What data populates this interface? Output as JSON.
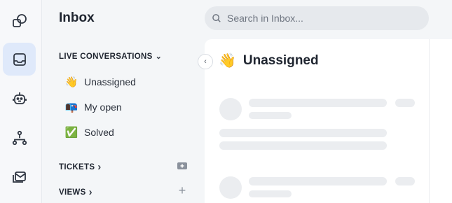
{
  "rail": {
    "items": [
      {
        "name": "shapes-icon",
        "active": false
      },
      {
        "name": "inbox-icon",
        "active": true
      },
      {
        "name": "bot-icon",
        "active": false
      },
      {
        "name": "org-chart-icon",
        "active": false
      },
      {
        "name": "mail-stack-icon",
        "active": false
      }
    ]
  },
  "sidebar": {
    "title": "Inbox",
    "live_section": {
      "label": "LIVE CONVERSATIONS",
      "chevron": "⌄"
    },
    "items": [
      {
        "emoji": "👋",
        "label": "Unassigned"
      },
      {
        "emoji": "📭",
        "label": "My open"
      },
      {
        "emoji": "✅",
        "label": "Solved"
      }
    ],
    "tickets_section": {
      "label": "TICKETS",
      "chevron": "›"
    },
    "views_section": {
      "label": "VIEWS",
      "chevron": "›",
      "action": "+"
    }
  },
  "search": {
    "placeholder": "Search in Inbox..."
  },
  "collapse": {
    "glyph": "‹"
  },
  "main": {
    "emoji": "👋",
    "title": "Unassigned"
  },
  "colors": {
    "accent_bg": "#dfe9fa",
    "skeleton": "#ebedf0"
  }
}
